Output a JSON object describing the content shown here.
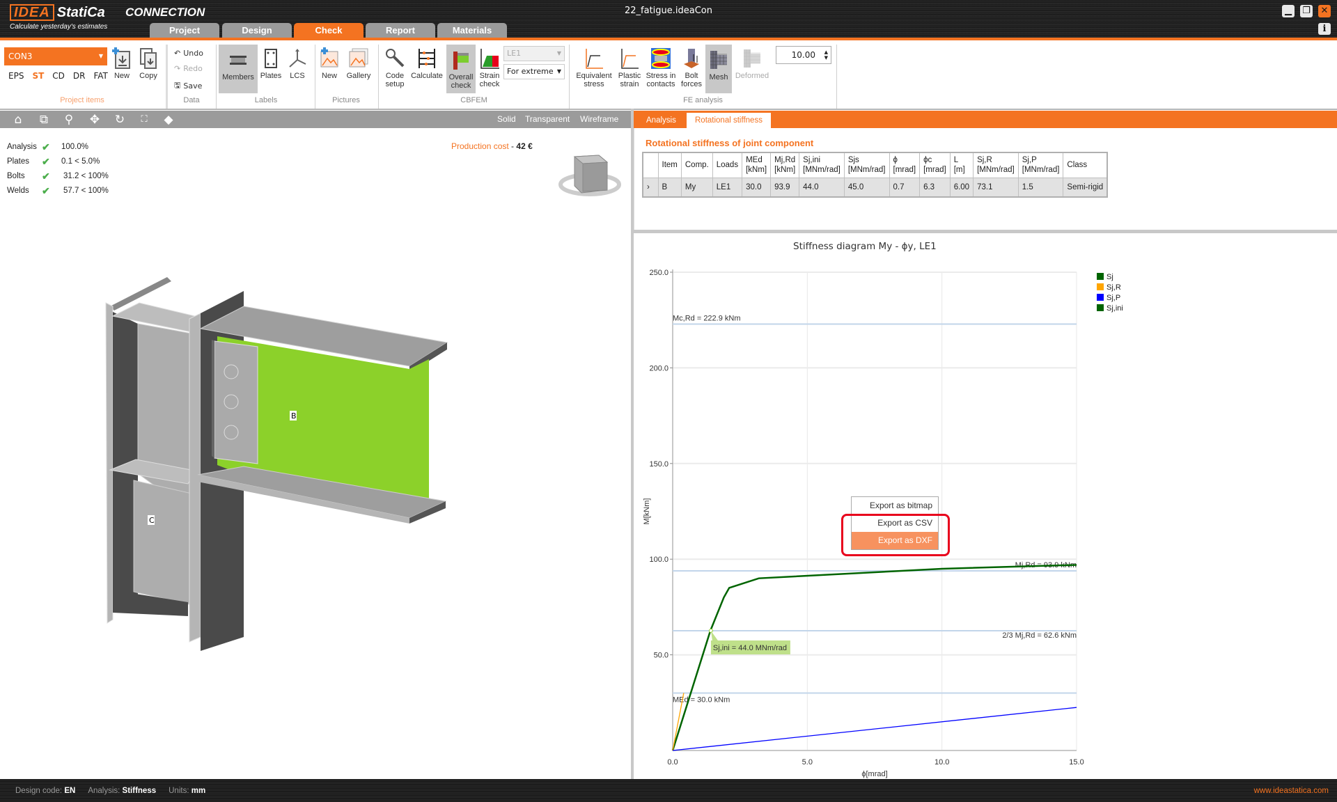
{
  "app": {
    "brand": "IDEA",
    "brand_rest": "StatiCa",
    "product": "CONNECTION",
    "tagline": "Calculate yesterday's estimates",
    "window_title": "22_fatigue.ideaCon",
    "window_buttons": {
      "minimize": "▁",
      "maximize": "❐",
      "close": "✕",
      "info": "i"
    }
  },
  "main_tabs": [
    {
      "label": "Project",
      "active": false
    },
    {
      "label": "Design",
      "active": false
    },
    {
      "label": "Check",
      "active": true
    },
    {
      "label": "Report",
      "active": false
    },
    {
      "label": "Materials",
      "active": false
    }
  ],
  "ribbon": {
    "project_items": {
      "label": "Project items",
      "connection_select": "CON3",
      "modes": [
        {
          "label": "EPS",
          "active": false
        },
        {
          "label": "ST",
          "active": true
        },
        {
          "label": "CD",
          "active": false
        },
        {
          "label": "DR",
          "active": false
        },
        {
          "label": "FAT",
          "active": false
        }
      ],
      "new": "New",
      "copy": "Copy"
    },
    "data": {
      "label": "Data",
      "undo": "Undo",
      "redo": "Redo",
      "save": "Save"
    },
    "labels": {
      "label": "Labels",
      "members": "Members",
      "plates": "Plates",
      "lcs": "LCS"
    },
    "pictures": {
      "label": "Pictures",
      "new": "New",
      "gallery": "Gallery"
    },
    "cbfem": {
      "label": "CBFEM",
      "code_setup": [
        "Code",
        "setup"
      ],
      "calculate": "Calculate",
      "overall_check": [
        "Overall",
        "check"
      ],
      "strain_check": [
        "Strain",
        "check"
      ],
      "load_effect_select": "LE1",
      "extreme_select": "For extreme"
    },
    "fe_analysis": {
      "label": "FE analysis",
      "equivalent_stress": [
        "Equivalent",
        "stress"
      ],
      "plastic_strain": [
        "Plastic",
        "strain"
      ],
      "stress_in_contacts": [
        "Stress in",
        "contacts"
      ],
      "bolt_forces": [
        "Bolt",
        "forces"
      ],
      "mesh": "Mesh",
      "deformed": "Deformed",
      "deformation_scale": "10.00"
    }
  },
  "view3d": {
    "view_modes": [
      "Solid",
      "Transparent",
      "Wireframe"
    ],
    "checks": [
      {
        "label": "Analysis",
        "value": "100.0%",
        "status": "ok"
      },
      {
        "label": "Plates",
        "value": "0.1 < 5.0%",
        "status": "ok"
      },
      {
        "label": "Bolts",
        "value": "31.2 < 100%",
        "status": "ok"
      },
      {
        "label": "Welds",
        "value": "57.7 < 100%",
        "status": "ok"
      }
    ],
    "production_cost_label": "Production cost",
    "production_cost_sep": " - ",
    "production_cost_value": "42 €",
    "member_labels": {
      "beam": "B",
      "column": "C"
    }
  },
  "results": {
    "tabs": [
      {
        "label": "Analysis",
        "active": false
      },
      {
        "label": "Rotational stiffness",
        "active": true
      }
    ],
    "section_title": "Rotational stiffness of joint component",
    "table": {
      "headers": [
        [
          "",
          ""
        ],
        [
          "Item",
          ""
        ],
        [
          "Comp.",
          ""
        ],
        [
          "Loads",
          ""
        ],
        [
          "MEd",
          "[kNm]"
        ],
        [
          "Mj,Rd",
          "[kNm]"
        ],
        [
          "Sj,ini",
          "[MNm/rad]"
        ],
        [
          "Sjs",
          "[MNm/rad]"
        ],
        [
          "ϕ",
          "[mrad]"
        ],
        [
          "ϕc",
          "[mrad]"
        ],
        [
          "L",
          "[m]"
        ],
        [
          "Sj,R",
          "[MNm/rad]"
        ],
        [
          "Sj,P",
          "[MNm/rad]"
        ],
        [
          "Class",
          ""
        ]
      ],
      "rows": [
        [
          "›",
          "B",
          "My",
          "LE1",
          "30.0",
          "93.9",
          "44.0",
          "45.0",
          "0.7",
          "6.3",
          "6.00",
          "73.1",
          "1.5",
          "Semi-rigid"
        ]
      ]
    }
  },
  "context_menu": {
    "items": [
      {
        "label": "Export as bitmap",
        "highlighted": false
      },
      {
        "label": "Export as CSV",
        "highlighted": false
      },
      {
        "label": "Export as DXF",
        "highlighted": true
      }
    ]
  },
  "chart_data": {
    "type": "line",
    "title": "Stiffness diagram My - ϕy, LE1",
    "xlabel": "ϕ[mrad]",
    "ylabel": "M[kNm]",
    "xlim": [
      0,
      15
    ],
    "ylim": [
      0,
      250
    ],
    "xticks": [
      "0.0",
      "5.0",
      "10.0",
      "15.0"
    ],
    "yticks": [
      "50.0",
      "100.0",
      "150.0",
      "200.0",
      "250.0"
    ],
    "grid": true,
    "legend_position": "top-right",
    "legend": [
      {
        "name": "Sj",
        "color": "#006400"
      },
      {
        "name": "Sj,R",
        "color": "#ffa500"
      },
      {
        "name": "Sj,P",
        "color": "#0000ff"
      },
      {
        "name": "Sj,ini",
        "color": "#006400"
      }
    ],
    "series": [
      {
        "name": "Sj",
        "color": "#006400",
        "x": [
          0,
          1.4,
          1.9,
          2.1,
          3.2,
          10,
          15
        ],
        "y": [
          0,
          62.6,
          80,
          85,
          90,
          95,
          97
        ]
      },
      {
        "name": "Sj,R",
        "color": "#ffa500",
        "x": [
          0,
          0.41
        ],
        "y": [
          0,
          30
        ]
      },
      {
        "name": "Sj,P",
        "color": "#0000ff",
        "x": [
          0,
          15
        ],
        "y": [
          0,
          22.5
        ]
      }
    ],
    "reference_lines": [
      {
        "label": "Mc,Rd = 222.9 kNm",
        "y": 222.9,
        "label_align": "left"
      },
      {
        "label": "Mj,Rd = 93.9 kNm",
        "y": 93.9,
        "label_align": "right"
      },
      {
        "label": "2/3 Mj,Rd = 62.6 kNm",
        "y": 62.6,
        "label_align": "right"
      },
      {
        "label": "MEd = 30.0 kNm",
        "y": 30.0,
        "label_align": "left"
      }
    ],
    "annotation": {
      "label": "Sj,ini = 44.0 MNm/rad",
      "x": 1.42,
      "y": 62.6
    }
  },
  "statusbar": {
    "design_code_label": "Design code:",
    "design_code": "EN",
    "analysis_label": "Analysis:",
    "analysis": "Stiffness",
    "units_label": "Units:",
    "units": "mm",
    "website": "www.ideastatica.com"
  }
}
